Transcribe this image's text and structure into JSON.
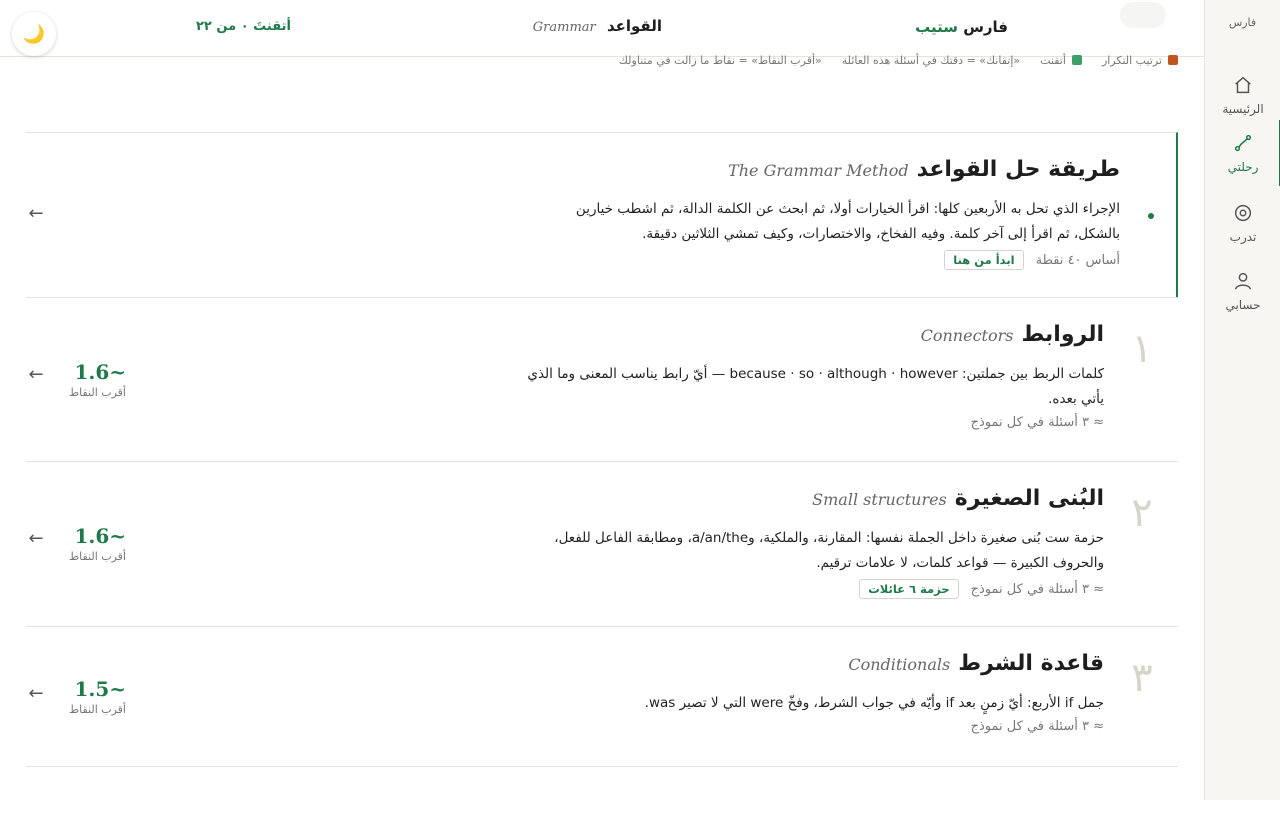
{
  "sidebar": {
    "brand": "فارس",
    "items": [
      {
        "label": "الرئيسية",
        "icon": "home-icon"
      },
      {
        "label": "رحلتي",
        "icon": "journey-icon",
        "active": true
      },
      {
        "label": "تدرب",
        "icon": "target-icon"
      },
      {
        "label": "حسابي",
        "icon": "user-icon"
      }
    ]
  },
  "header": {
    "brand_main": "فارس",
    "brand_accent": "ستيب",
    "section_title": "القواعد",
    "section_latin": "Grammar",
    "mastered": "أتقنتَ ٠ من ٢٢",
    "theme_icon": "🌙"
  },
  "legend": {
    "review": "ترتيب التكرار",
    "mastered": "أتقنت",
    "note1": "«إتقانك» = دقتك في أسئلة هذه العائلة",
    "note2": "«أقرب النقاط» = نقاط ما زالت في متناولك",
    "colors": {
      "review": "#c0561f",
      "mastered": "#3aa066"
    }
  },
  "intro": {
    "title": "طريقة حل القواعد",
    "latin": "The Grammar Method",
    "desc": "الإجراء الذي تحل به الأربعين كلها: اقرأ الخيارات أولا، ثم ابحث عن الكلمة الدالة، ثم اشطب خيارين بالشكل، ثم اقرأ إلى آخر كلمة. وفيه الفخاخ، والاختصارات، وكيف تمشي الثلاثين دقيقة.",
    "meta": "أساس ٤٠ نقطة",
    "tag": "ابدأ من هنا"
  },
  "lessons": [
    {
      "num": "١",
      "title": "الروابط",
      "latin": "Connectors",
      "desc": "كلمات الربط بين جملتين: because · so · although · however — أيّ رابط يناسب المعنى وما الذي يأتي بعده.",
      "meta": "≈ ٣ أسئلة في كل نموذج",
      "score": "~1.6",
      "score_caption": "أقرب النقاط"
    },
    {
      "num": "٢",
      "title": "البُنى الصغيرة",
      "latin": "Small structures",
      "desc": "حزمة ست بُنى صغيرة داخل الجملة نفسها: المقارنة، والملكية، وa/an/the، ومطابقة الفاعل للفعل، والحروف الكبيرة — قواعد كلمات، لا علامات ترقيم.",
      "meta": "≈ ٣ أسئلة في كل نموذج",
      "tag": "حزمة ٦ عائلات",
      "score": "~1.6",
      "score_caption": "أقرب النقاط"
    },
    {
      "num": "٣",
      "title": "قاعدة الشرط",
      "latin": "Conditionals",
      "desc": "جمل if الأربع: أيّ زمنٍ بعد if وأيّه في جواب الشرط، وفخّ were التي لا تصير was.",
      "meta": "≈ ٣ أسئلة في كل نموذج",
      "score": "~1.5",
      "score_caption": "أقرب النقاط"
    }
  ]
}
